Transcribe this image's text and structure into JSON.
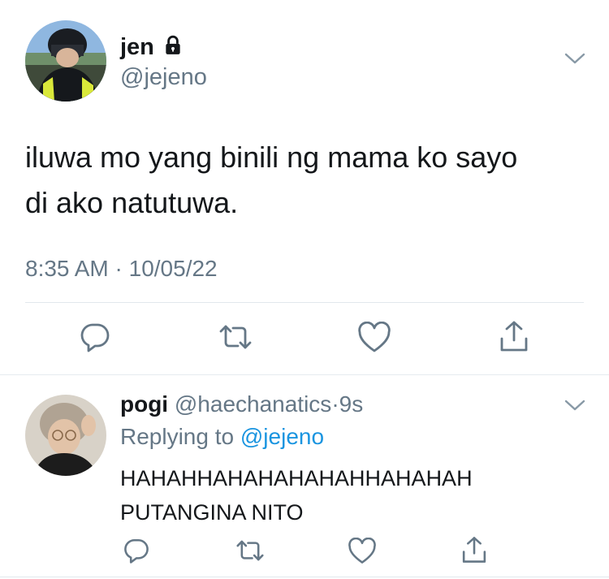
{
  "main_tweet": {
    "author_name": "jen",
    "author_handle": "@jejeno",
    "protected_icon": "lock-icon",
    "text_line1": "iluwa mo yang binili ng mama ko sayo",
    "text_line2": "di ako natutuwa.",
    "time": "8:35 AM",
    "separator": "·",
    "date": "10/05/22",
    "actions": [
      "reply-icon",
      "retweet-icon",
      "like-icon",
      "share-icon"
    ]
  },
  "reply_tweet": {
    "author_name": "pogi",
    "author_handle": "@haechanatics",
    "separator": "·",
    "age": "9s",
    "replying_prefix": "Replying to",
    "replying_handle": "@jejeno",
    "text_line1": "HAHAHHAHAHAHAHAHHAHAHAH",
    "text_line2": "PUTANGINA NITO",
    "actions": [
      "reply-icon",
      "retweet-icon",
      "like-icon",
      "share-icon"
    ]
  },
  "colors": {
    "text": "#14171a",
    "muted": "#657786",
    "link": "#1b95e0",
    "divider": "#e1e8ed"
  }
}
